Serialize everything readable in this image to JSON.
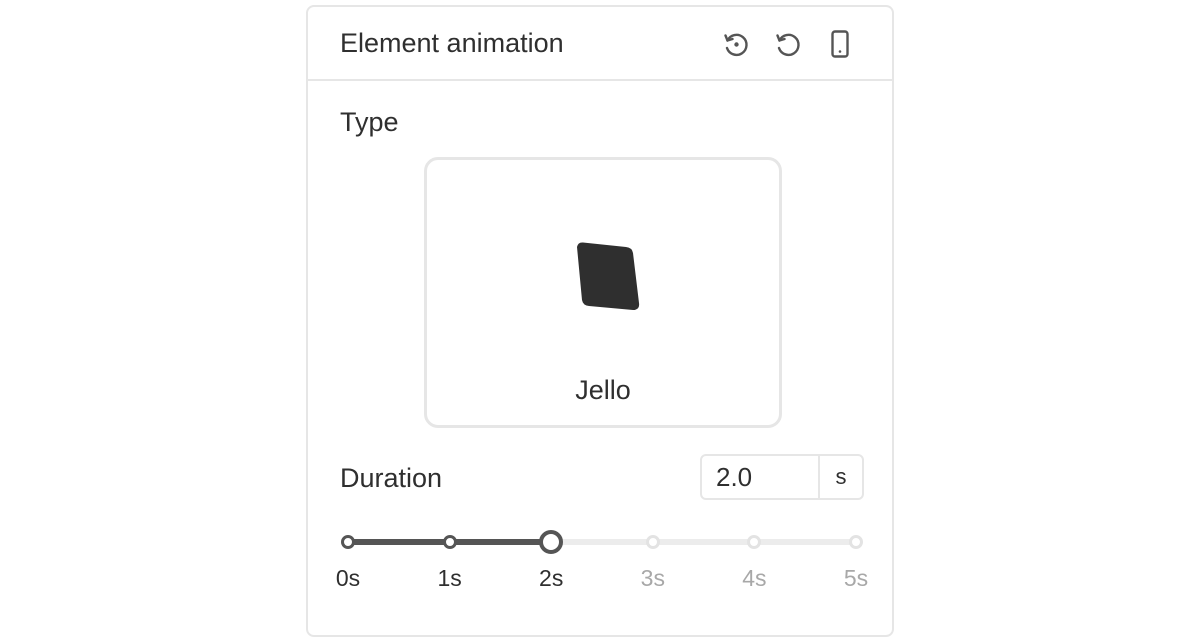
{
  "header": {
    "title": "Element animation",
    "icons": [
      "replay-icon",
      "reset-icon",
      "mobile-device-icon"
    ]
  },
  "type_section": {
    "label": "Type",
    "selected_name": "Jello",
    "preview_icon": "jello-shape-icon"
  },
  "duration": {
    "label": "Duration",
    "value": "2.0",
    "unit": "s",
    "slider_value": 2,
    "slider_min": 0,
    "slider_max": 5,
    "ticks": [
      "0s",
      "1s",
      "2s",
      "3s",
      "4s",
      "5s"
    ]
  },
  "colors": {
    "active": "#555555",
    "inactive": "#e3e3e3",
    "text": "#2f2f2f",
    "muted_text": "#a8a8a8",
    "border": "#e6e6e6"
  }
}
